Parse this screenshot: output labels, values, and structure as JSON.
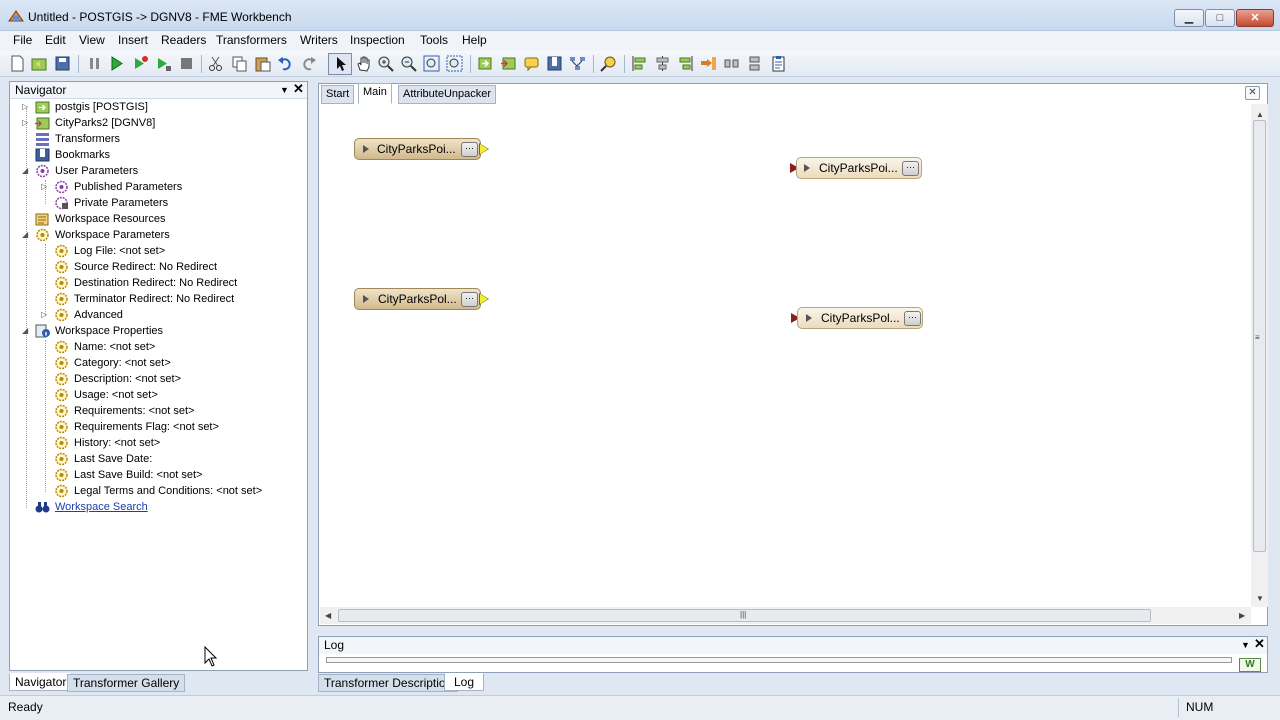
{
  "window": {
    "title": "Untitled - POSTGIS -> DGNV8 - FME Workbench",
    "min_label": "▁",
    "max_label": "□",
    "close_label": "✕"
  },
  "menu": [
    "File",
    "Edit",
    "View",
    "Insert",
    "Readers",
    "Transformers",
    "Writers",
    "Inspection",
    "Tools",
    "Help"
  ],
  "toolbar_icons": [
    "new-icon",
    "open-icon",
    "save-icon",
    "pause-icon",
    "run-icon",
    "run-to-icon",
    "partial-run-icon",
    "stop-icon",
    "cut-icon",
    "copy-icon",
    "paste-icon",
    "undo-icon",
    "redo-icon",
    "select-icon",
    "pan-icon",
    "zoom-in-icon",
    "zoom-out-icon",
    "zoom-fit-icon",
    "zoom-selection-icon",
    "add-reader-icon",
    "add-writer-icon",
    "annotation-icon",
    "bookmark-icon",
    "autolayout-icon",
    "inspect-icon",
    "align-left-icon",
    "align-center-icon",
    "align-right-icon",
    "sequence-icon",
    "distribute-h-icon",
    "distribute-v-icon",
    "clipboard-icon"
  ],
  "navigator": {
    "title": "Navigator",
    "items": [
      {
        "label": "postgis [POSTGIS]",
        "icon": "reader-db-icon"
      },
      {
        "label": "CityParks2 [DGNV8]",
        "icon": "writer-icon"
      },
      {
        "label": "Transformers",
        "icon": "transformers-icon"
      },
      {
        "label": "Bookmarks",
        "icon": "bookmarks-icon"
      },
      {
        "label": "User Parameters",
        "icon": "parameters-icon"
      },
      {
        "label": "Published Parameters",
        "icon": "parameters-icon"
      },
      {
        "label": "Private Parameters",
        "icon": "private-parameters-icon"
      },
      {
        "label": "Workspace Resources",
        "icon": "resources-icon"
      },
      {
        "label": "Workspace Parameters",
        "icon": "parameters-icon"
      },
      {
        "label": "Log File: <not set>",
        "icon": "setting-icon"
      },
      {
        "label": "Source Redirect: No Redirect",
        "icon": "setting-icon"
      },
      {
        "label": "Destination Redirect: No Redirect",
        "icon": "setting-icon"
      },
      {
        "label": "Terminator Redirect: No Redirect",
        "icon": "setting-icon"
      },
      {
        "label": "Advanced",
        "icon": "setting-icon"
      },
      {
        "label": "Workspace Properties",
        "icon": "properties-icon"
      },
      {
        "label": "Name: <not set>",
        "icon": "setting-icon"
      },
      {
        "label": "Category: <not set>",
        "icon": "setting-icon"
      },
      {
        "label": "Description: <not set>",
        "icon": "setting-icon"
      },
      {
        "label": "Usage: <not set>",
        "icon": "setting-icon"
      },
      {
        "label": "Requirements: <not set>",
        "icon": "setting-icon"
      },
      {
        "label": "Requirements Flag: <not set>",
        "icon": "setting-icon"
      },
      {
        "label": "History: <not set>",
        "icon": "setting-icon"
      },
      {
        "label": "Last Save Date:",
        "icon": "setting-icon"
      },
      {
        "label": "Last Save Build: <not set>",
        "icon": "setting-icon"
      },
      {
        "label": "Legal Terms and Conditions: <not set>",
        "icon": "setting-icon"
      },
      {
        "label": "Workspace Search",
        "icon": "binoculars-icon"
      }
    ],
    "tabs": [
      "Navigator",
      "Transformer Gallery"
    ]
  },
  "canvas": {
    "tabs": [
      "Start",
      "Main",
      "AttributeUnpacker"
    ],
    "active_tab": "Main",
    "readers": [
      "CityParksPoi...",
      "CityParksPol..."
    ],
    "writers": [
      "CityParksPoi...",
      "CityParksPol..."
    ],
    "dots_label": "···"
  },
  "log": {
    "title": "Log",
    "icon_label": "W"
  },
  "bottom_tabs": [
    "Transformer Description",
    "Log"
  ],
  "status": {
    "text": "Ready",
    "num": "NUM"
  }
}
